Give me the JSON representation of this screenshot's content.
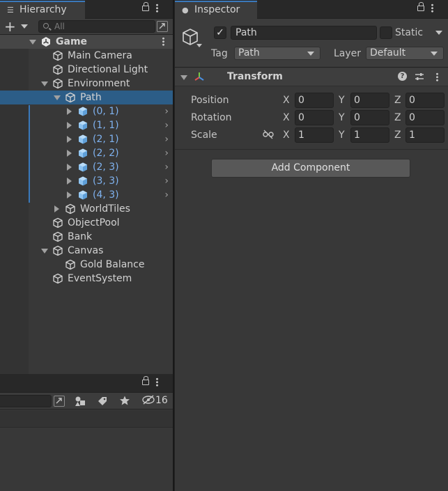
{
  "hierarchy": {
    "tab_title": "Hierarchy",
    "search_placeholder": "All",
    "add_label": "+",
    "items": [
      {
        "label": "Game",
        "depth": 0,
        "expand": "open",
        "icon": "unity-scene-icon",
        "type": "scene"
      },
      {
        "label": "Main Camera",
        "depth": 1,
        "expand": "none",
        "icon": "cube-icon"
      },
      {
        "label": "Directional Light",
        "depth": 1,
        "expand": "none",
        "icon": "cube-icon"
      },
      {
        "label": "Environment",
        "depth": 1,
        "expand": "open",
        "icon": "cube-icon"
      },
      {
        "label": "Path",
        "depth": 2,
        "expand": "open",
        "icon": "cube-icon",
        "selected": true
      },
      {
        "label": "(0, 1)",
        "depth": 3,
        "expand": "closed",
        "icon": "prefab-icon",
        "prefab": true
      },
      {
        "label": "(1, 1)",
        "depth": 3,
        "expand": "closed",
        "icon": "prefab-icon",
        "prefab": true
      },
      {
        "label": "(2, 1)",
        "depth": 3,
        "expand": "closed",
        "icon": "prefab-icon",
        "prefab": true
      },
      {
        "label": "(2, 2)",
        "depth": 3,
        "expand": "closed",
        "icon": "prefab-icon",
        "prefab": true
      },
      {
        "label": "(2, 3)",
        "depth": 3,
        "expand": "closed",
        "icon": "prefab-icon",
        "prefab": true
      },
      {
        "label": "(3, 3)",
        "depth": 3,
        "expand": "closed",
        "icon": "prefab-icon",
        "prefab": true
      },
      {
        "label": "(4, 3)",
        "depth": 3,
        "expand": "closed",
        "icon": "prefab-icon",
        "prefab": true
      },
      {
        "label": "WorldTiles",
        "depth": 2,
        "expand": "closed",
        "icon": "cube-icon"
      },
      {
        "label": "ObjectPool",
        "depth": 1,
        "expand": "none",
        "icon": "cube-icon"
      },
      {
        "label": "Bank",
        "depth": 1,
        "expand": "none",
        "icon": "cube-icon"
      },
      {
        "label": "Canvas",
        "depth": 1,
        "expand": "open",
        "icon": "cube-icon"
      },
      {
        "label": "Gold Balance",
        "depth": 2,
        "expand": "none",
        "icon": "cube-icon"
      },
      {
        "label": "EventSystem",
        "depth": 1,
        "expand": "none",
        "icon": "cube-icon"
      }
    ]
  },
  "project": {
    "hidden_count": "16"
  },
  "inspector": {
    "tab_title": "Inspector",
    "object_name": "Path",
    "active_checked": "✓",
    "static_label": "Static",
    "tag_label": "Tag",
    "tag_value": "Path",
    "layer_label": "Layer",
    "layer_value": "Default",
    "transform": {
      "title": "Transform",
      "position_label": "Position",
      "rotation_label": "Rotation",
      "scale_label": "Scale",
      "axis_x": "X",
      "axis_y": "Y",
      "axis_z": "Z",
      "position": {
        "x": "0",
        "y": "0",
        "z": "0"
      },
      "rotation": {
        "x": "0",
        "y": "0",
        "z": "0"
      },
      "scale": {
        "x": "1",
        "y": "1",
        "z": "1"
      }
    },
    "add_component_label": "Add Component"
  },
  "colors": {
    "panel": "#383838",
    "selection": "#2c5d87",
    "tab_accent": "#3a79bb",
    "prefab_text": "#7fb2ef"
  }
}
